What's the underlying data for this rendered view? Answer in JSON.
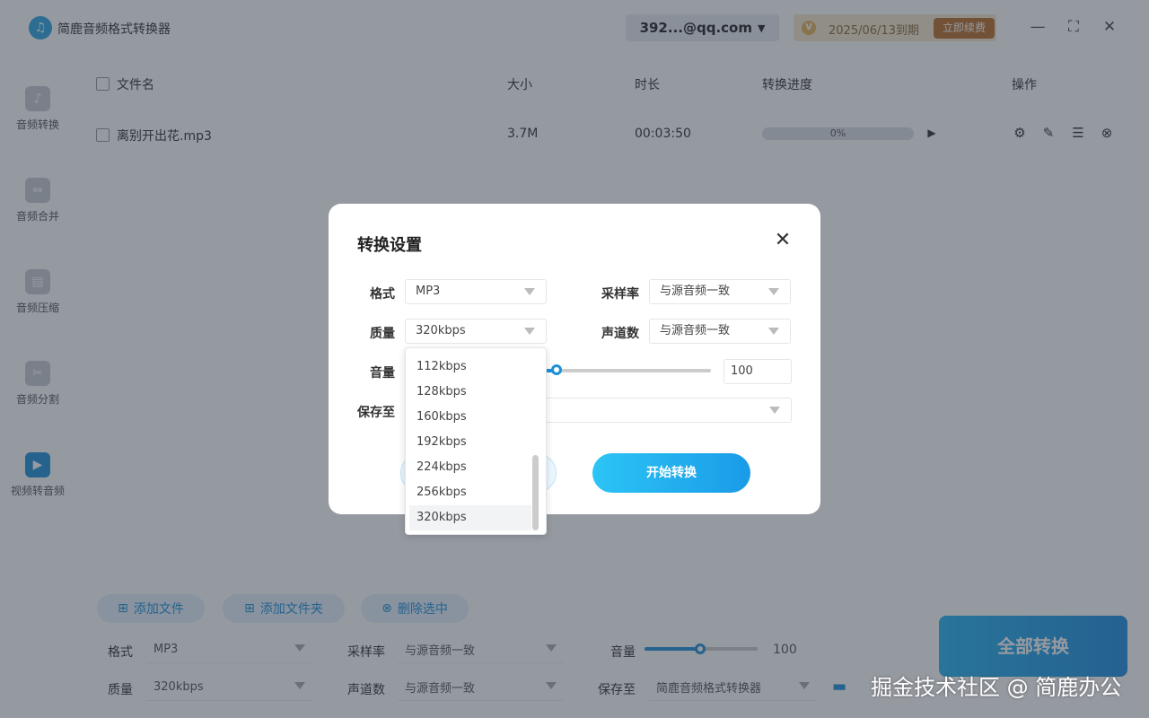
{
  "app": {
    "title": "简鹿音频格式转换器",
    "account": "392...@qq.com",
    "expiry": "2025/06/13到期",
    "renew_label": "立即续费"
  },
  "sidebar": {
    "items": [
      {
        "label": "音频转换",
        "icon": "music-note-icon"
      },
      {
        "label": "音频合并",
        "icon": "merge-icon"
      },
      {
        "label": "音频压缩",
        "icon": "compress-icon"
      },
      {
        "label": "音频分割",
        "icon": "split-icon"
      },
      {
        "label": "视频转音频",
        "icon": "video-camera-icon",
        "active": true
      }
    ]
  },
  "table": {
    "headers": {
      "name": "文件名",
      "size": "大小",
      "duration": "时长",
      "progress": "转换进度",
      "actions": "操作"
    },
    "rows": [
      {
        "name": "离别开出花.mp3",
        "size": "3.7M",
        "duration": "00:03:50",
        "progress_text": "0%",
        "progress": 0
      }
    ]
  },
  "toolbar": {
    "add_file": "添加文件",
    "add_folder": "添加文件夹",
    "delete_selected": "删除选中"
  },
  "bottom": {
    "format_label": "格式",
    "format_value": "MP3",
    "samplerate_label": "采样率",
    "samplerate_value": "与源音频一致",
    "volume_label": "音量",
    "volume_value": "100",
    "quality_label": "质量",
    "quality_value": "320kbps",
    "channels_label": "声道数",
    "channels_value": "与源音频一致",
    "saveto_label": "保存至",
    "saveto_value": "简鹿音频格式转换器",
    "convert_all": "全部转换"
  },
  "modal": {
    "title": "转换设置",
    "format_label": "格式",
    "format_value": "MP3",
    "samplerate_label": "采样率",
    "samplerate_value": "与源音频一致",
    "quality_label": "质量",
    "quality_value": "320kbps",
    "channels_label": "声道数",
    "channels_value": "与源音频一致",
    "volume_label": "音量",
    "volume_value": "100",
    "saveto_label": "保存至",
    "start_label": "开始转换"
  },
  "quality_dropdown": {
    "options": [
      "112kbps",
      "128kbps",
      "160kbps",
      "192kbps",
      "224kbps",
      "256kbps",
      "320kbps"
    ],
    "selected": "320kbps"
  },
  "watermark": "掘金技术社区 @ 简鹿办公",
  "colors": {
    "accent": "#1e90d8",
    "renew": "#b86f2c"
  }
}
